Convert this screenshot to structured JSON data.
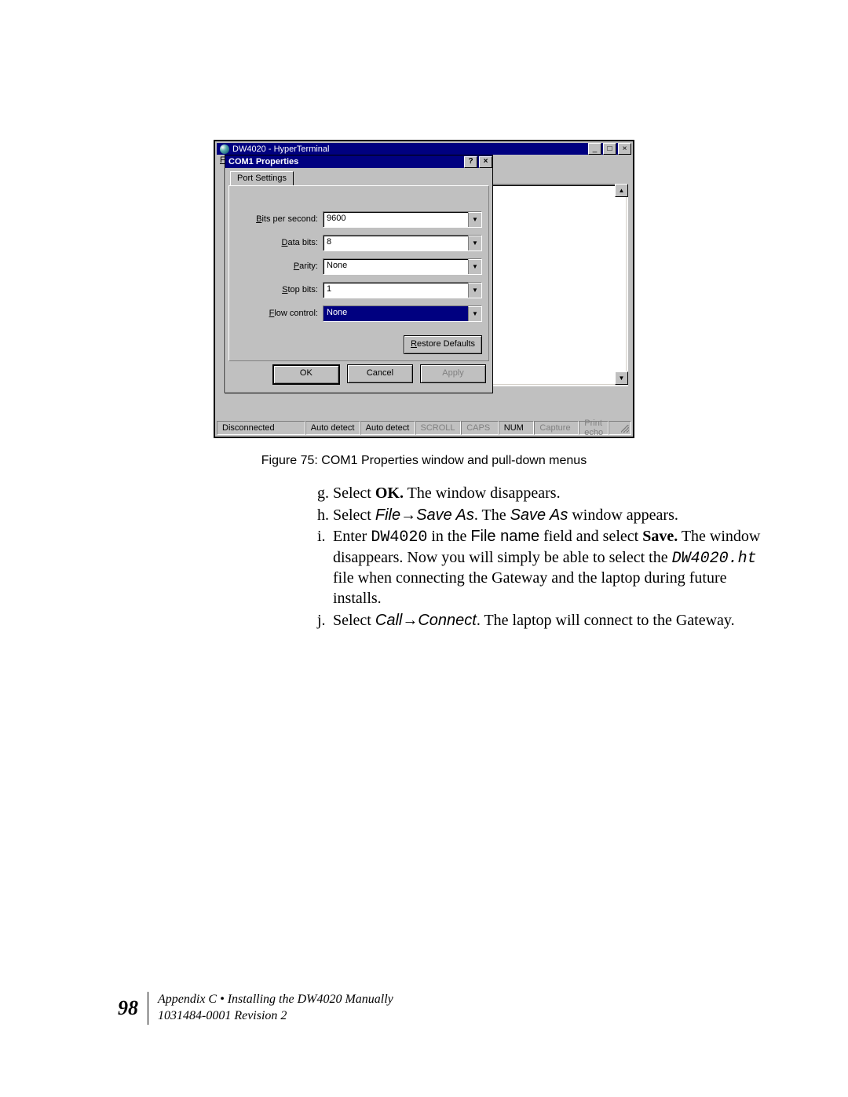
{
  "screenshot": {
    "hyperterminal": {
      "title": "DW4020 - HyperTerminal",
      "menu_file": "F",
      "status": {
        "conn": "Disconnected",
        "detect1": "Auto detect",
        "detect2": "Auto detect",
        "scroll": "SCROLL",
        "caps": "CAPS",
        "num": "NUM",
        "capture": "Capture",
        "printecho": "Print echo"
      }
    },
    "dialog": {
      "title": "COM1 Properties",
      "tab": "Port Settings",
      "fields": {
        "bps_label": "Bits per second:",
        "bps_value": "9600",
        "databits_label": "Data bits:",
        "databits_value": "8",
        "parity_label": "Parity:",
        "parity_value": "None",
        "stopbits_label": "Stop bits:",
        "stopbits_value": "1",
        "flow_label": "Flow control:",
        "flow_value": "None"
      },
      "restore": "Restore Defaults",
      "ok": "OK",
      "cancel": "Cancel",
      "apply": "Apply"
    }
  },
  "caption": "Figure 75:  COM1 Properties window and pull-down menus",
  "steps": {
    "g_prefix": "g.",
    "g_a": "Select ",
    "g_b": "OK.",
    "g_c": " The window disappears.",
    "h_prefix": "h.",
    "h_a": "Select ",
    "h_b": "File→Save As",
    "h_c": ". The ",
    "h_d": "Save As",
    "h_e": " window appears.",
    "i_prefix": "i.",
    "i_a": "Enter ",
    "i_b": "DW4020",
    "i_c": " in the ",
    "i_d": "File name",
    "i_e": " field and select ",
    "i_f": "Save.",
    "i_g": " The window disappears. Now you will simply be able to select the ",
    "i_h": "DW4020.ht",
    "i_i": " file when connecting the Gateway and the laptop during future installs.",
    "j_prefix": "j.",
    "j_a": "Select ",
    "j_b": "Call→Connect",
    "j_c": ". The laptop will connect to the Gateway."
  },
  "footer": {
    "page": "98",
    "line1": "Appendix C • Installing the DW4020 Manually",
    "line2": "1031484-0001  Revision 2"
  }
}
